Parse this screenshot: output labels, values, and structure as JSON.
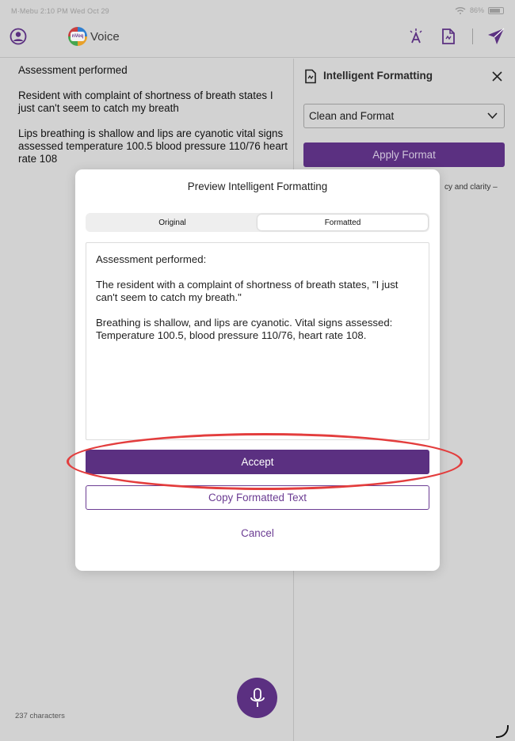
{
  "status_bar": {
    "left": "M·Mebu 2:10 PM Wed Oct 29",
    "right": "86%"
  },
  "header": {
    "app_name": "Voice",
    "logo_text": "nVoq"
  },
  "note": {
    "paragraphs": [
      "Assessment performed",
      "Resident with complaint of shortness of breath states I just can't seem to catch my breath",
      "Lips breathing is shallow and lips are cyanotic vital signs assessed temperature 100.5 blood pressure 110/76 heart rate 108"
    ],
    "char_count": "237 characters"
  },
  "panel": {
    "title": "Intelligent Formatting",
    "select_value": "Clean and Format",
    "apply_label": "Apply Format",
    "description_fragment": "cy and clarity –"
  },
  "modal": {
    "title": "Preview Intelligent Formatting",
    "tabs": [
      {
        "label": "Original"
      },
      {
        "label": "Formatted"
      }
    ],
    "active_tab": "Formatted",
    "formatted_paragraphs": [
      "Assessment performed:",
      "The resident with a complaint of shortness of breath states, \"I just can't seem to catch my breath.\"",
      "Breathing is shallow, and lips are cyanotic. Vital signs assessed: Temperature 100.5, blood pressure 110/76, heart rate 108."
    ],
    "accept_label": "Accept",
    "copy_label": "Copy Formatted Text",
    "cancel_label": "Cancel"
  },
  "colors": {
    "brand_purple": "#5b3081",
    "link_purple": "#6c3d93",
    "highlight_red": "#e33d3d"
  },
  "icons": [
    "account-icon",
    "nvoq-logo",
    "text-spark-icon",
    "document-format-icon",
    "send-icon",
    "close-icon",
    "chevron-down-icon",
    "microphone-icon"
  ]
}
